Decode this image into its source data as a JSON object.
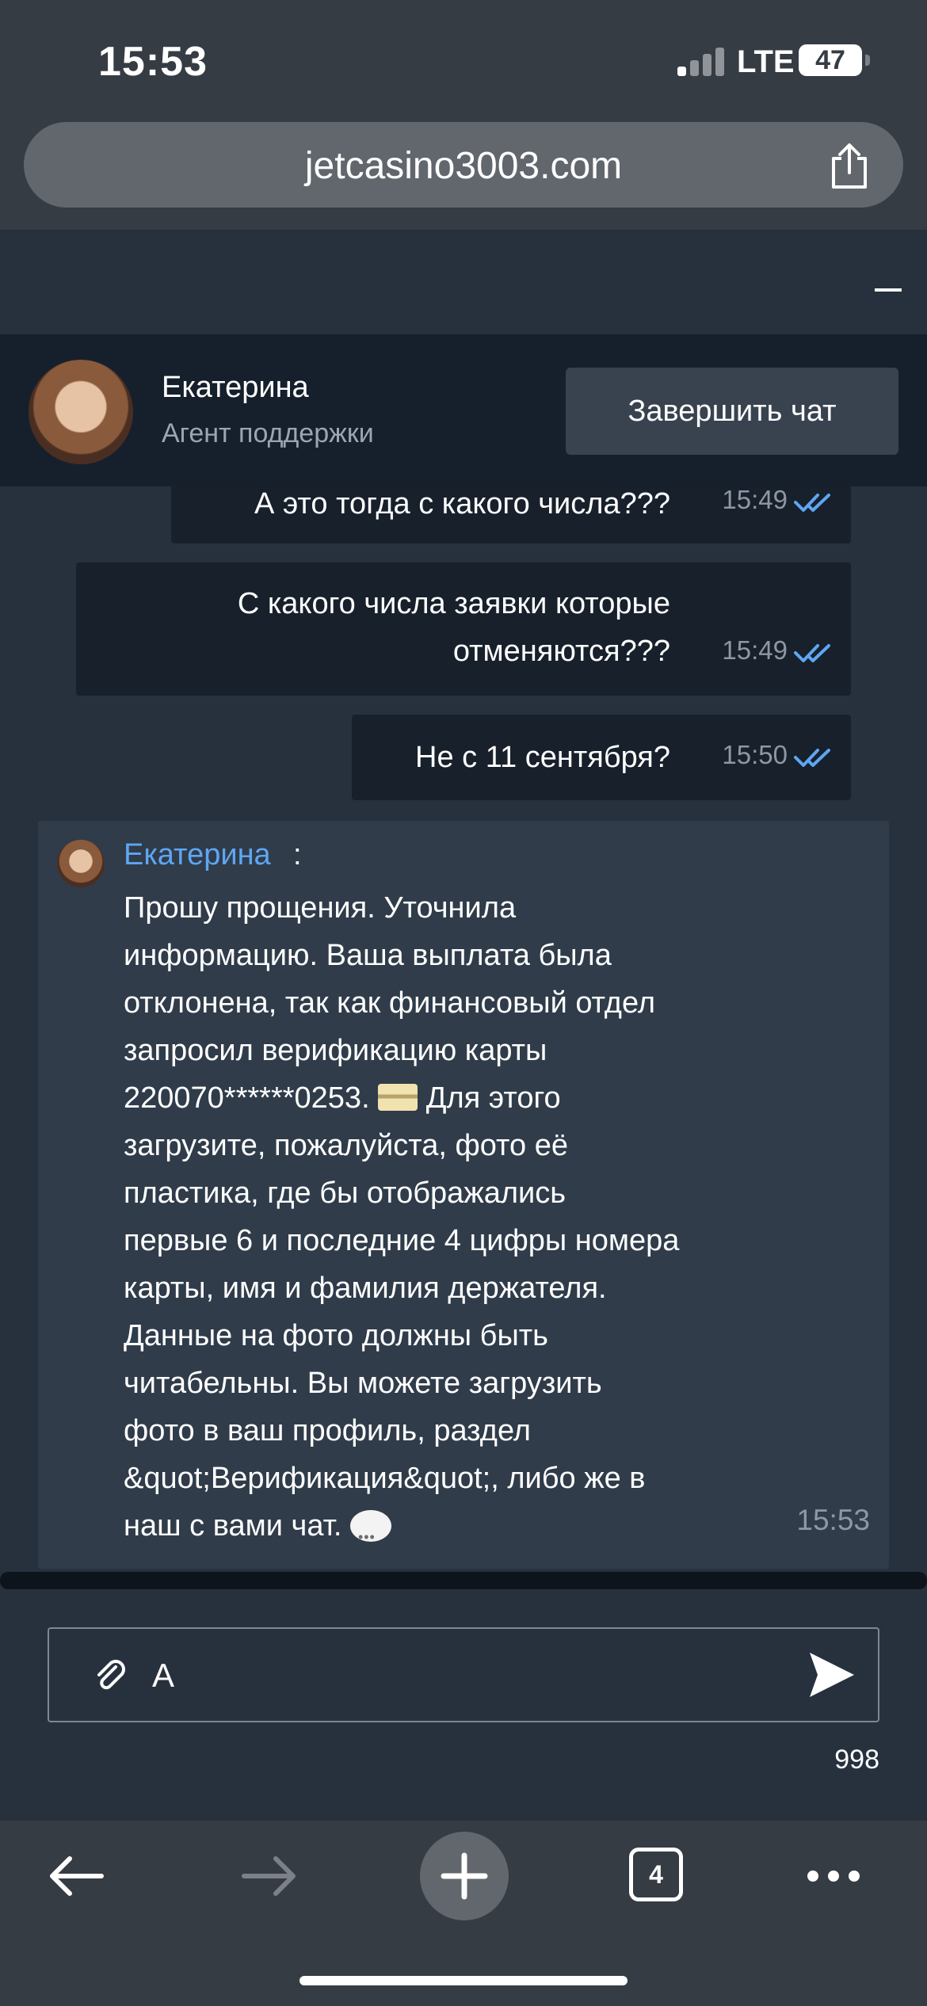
{
  "status_bar": {
    "time": "15:53",
    "network": "LTE",
    "battery": "47"
  },
  "browser": {
    "url": "jetcasino3003.com",
    "tab_count": "4"
  },
  "chat_header": {
    "agent_name": "Екатерина",
    "agent_role": "Агент поддержки",
    "end_chat_label": "Завершить чат"
  },
  "messages": [
    {
      "text": "А это тогда с какого числа???",
      "time": "15:49"
    },
    {
      "line1": "С какого числа заявки которые",
      "line2": "отменяются???",
      "time": "15:49"
    },
    {
      "text": "Не с 11 сентября?",
      "time": "15:50"
    }
  ],
  "agent_message": {
    "name": "Екатерина",
    "separator": ":",
    "body_part1": "Прошу прощения. Уточнила\nинформацию. Ваша выплата была\nотклонена, так как финансовый отдел\nзапросил верификацию карты\n220070******0253. ",
    "body_part2": " Для этого\nзагрузите, пожалуйста, фото её\nпластика, где бы отображались\nпервые 6 и последние 4 цифры номера\nкарты, имя и фамилия держателя.\nДанные на фото должны быть\nчитабельны. Вы можете загрузить\nфото в ваш профиль, раздел\n&quot;Верификация&quot;, либо же в\nнаш с вами чат. ",
    "time": "15:53"
  },
  "composer": {
    "value": "А",
    "char_counter": "998"
  },
  "icons": {
    "card": "credit-card-emoji",
    "speech": "speech-bubble-emoji",
    "attach": "paperclip-icon",
    "send": "send-icon",
    "read_status": "double-check-icon"
  },
  "colors": {
    "accent_blue": "#5ea6f2",
    "background": "#27313e",
    "header_bg": "#16202c",
    "bubble_dark": "#17202b",
    "bubble_agent": "#303c4a"
  }
}
